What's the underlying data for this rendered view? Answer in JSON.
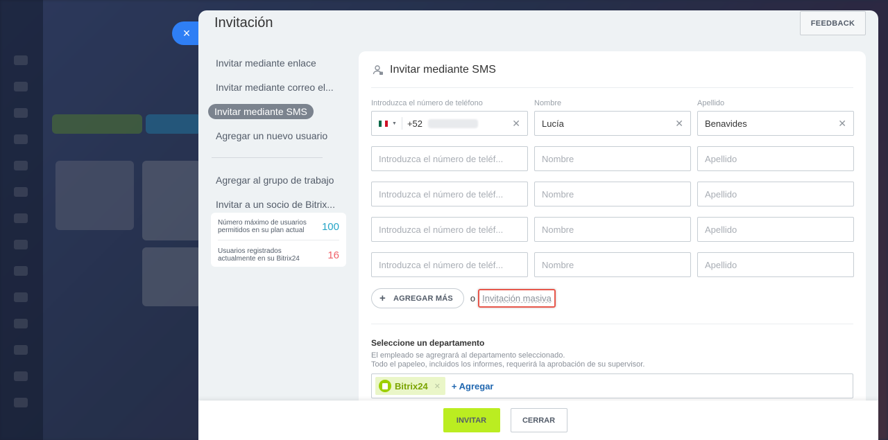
{
  "slider": {
    "title": "Invitación",
    "close_icon": "×",
    "feedback_label": "FEEDBACK"
  },
  "menu": {
    "items": [
      {
        "label": "Invitar mediante enlace",
        "active": false
      },
      {
        "label": "Invitar mediante correo el...",
        "active": false
      },
      {
        "label": "Invitar mediante SMS",
        "active": true
      },
      {
        "label": "Agregar un nuevo usuario",
        "active": false
      }
    ],
    "items2": [
      {
        "label": "Agregar al grupo de trabajo"
      },
      {
        "label": "Invitar a un socio de Bitrix..."
      }
    ]
  },
  "stats": {
    "max_label": "Número máximo de usuarios permitidos en su plan actual",
    "max_value": "100",
    "registered_label": "Usuarios registrados actualmente en su Bitrix24",
    "registered_value": "16"
  },
  "form": {
    "header": "Invitar mediante SMS",
    "labels": {
      "phone": "Introduzca el número de teléfono",
      "name": "Nombre",
      "surname": "Apellido"
    },
    "first_row": {
      "country_code": "+52",
      "name": "Lucía",
      "surname": "Benavides"
    },
    "placeholders": {
      "phone": "Introduzca el número de teléf...",
      "name": "Nombre",
      "surname": "Apellido"
    },
    "add_more": "AGREGAR MÁS",
    "or": "o",
    "mass_invite": "Invitación masiva"
  },
  "department": {
    "title": "Seleccione un departamento",
    "desc1": "El empleado se agregrará al departamento seleccionado.",
    "desc2": "Todo el papeleo, incluidos los informes, requerirá la aprobación de su supervisor.",
    "tag": "Bitrix24",
    "add": "+ Agregar"
  },
  "footer": {
    "invite": "INVITAR",
    "close": "CERRAR"
  },
  "colors": {
    "accent_green": "#bbed21",
    "link_blue": "#2067b0",
    "highlight_red": "#e8574b"
  }
}
